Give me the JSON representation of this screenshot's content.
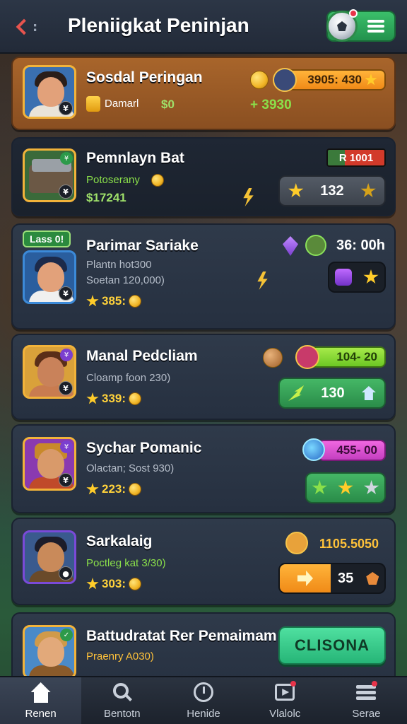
{
  "header": {
    "title": "Pleniigkat Peninjan",
    "back_label": ":"
  },
  "cards": [
    {
      "name": "Sosdal Peringan",
      "sub": "Damarl",
      "amount": "$0",
      "pill_value": "3905: 430",
      "right_amount": "+ 3930"
    },
    {
      "name": "Pemnlayn Bat",
      "sub": "Potoserany",
      "amount": "$17241",
      "tag_value": "R 1001",
      "box_value": "132"
    },
    {
      "level_tag": "Lass 0!",
      "name": "Parimar Sariake",
      "sub1": "Plantn hot300",
      "sub2": "Soetan 120,000)",
      "score": "385:",
      "timer": "36: 00h"
    },
    {
      "name": "Manal Pedcliam",
      "sub": "Cloamp foon 230)",
      "score": "339:",
      "pill_value": "104- 20",
      "box_value": "130"
    },
    {
      "name": "Sychar Pomanic",
      "sub": "Olactan; Sost 930)",
      "score": "223:",
      "pill_value": "455- 00"
    },
    {
      "name": "Sarkalaig",
      "sub": "Poctleg kat 3/30)",
      "score": "303:",
      "value_text": "1105.5050",
      "box_value": "35"
    },
    {
      "name": "Battudratat Rer Pemaimam",
      "sub": "Praenry A030)",
      "cta_label": "CLISONA"
    }
  ],
  "nav": [
    {
      "label": "Renen",
      "icon": "home-icon"
    },
    {
      "label": "Bentotn",
      "icon": "search-icon"
    },
    {
      "label": "Henide",
      "icon": "clock-icon"
    },
    {
      "label": "Vlalolc",
      "icon": "video-icon"
    },
    {
      "label": "Serae",
      "icon": "stack-icon"
    }
  ],
  "colors": {
    "accent_orange": "#f08a17",
    "accent_green": "#6cc724",
    "accent_pink": "#c43fc0",
    "cta_green": "#26b577"
  }
}
